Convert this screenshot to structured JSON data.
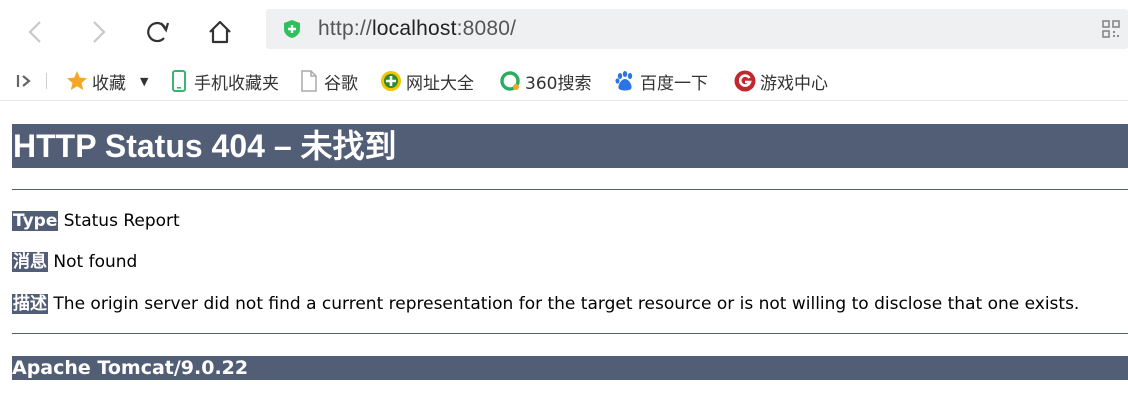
{
  "browser": {
    "url_scheme": "http://",
    "url_host": "localhost",
    "url_rest": ":8080/",
    "icons": {
      "back": "back-arrow-icon",
      "forward": "forward-arrow-icon",
      "reload": "reload-icon",
      "home": "home-icon",
      "security": "shield-plus-icon",
      "qr": "qr-code-icon"
    }
  },
  "bookmarks": {
    "items": [
      {
        "label": "收藏",
        "icon": "star-icon",
        "color": "#f5a623"
      },
      {
        "label": "手机收藏夹",
        "icon": "phone-icon",
        "color": "#3cb371"
      },
      {
        "label": "谷歌",
        "icon": "page-icon",
        "color": "#999999"
      },
      {
        "label": "网址大全",
        "icon": "plus-circle-icon",
        "color": "#2e8b2e"
      },
      {
        "label": "360搜索",
        "icon": "search-360-icon",
        "color": "#27ae60"
      },
      {
        "label": "百度一下",
        "icon": "baidu-paw-icon",
        "color": "#2a74e6"
      },
      {
        "label": "游戏中心",
        "icon": "game-g-icon",
        "color": "#c0282d"
      }
    ]
  },
  "page": {
    "title": "HTTP Status 404 – 未找到",
    "type_label": "Type",
    "type_value": "Status Report",
    "message_label": "消息",
    "message_value": "Not found",
    "description_label": "描述",
    "description_value": "The origin server did not find a current representation for the target resource or is not willing to disclose that one exists.",
    "footer": "Apache Tomcat/9.0.22",
    "accent_color": "#525d76"
  }
}
